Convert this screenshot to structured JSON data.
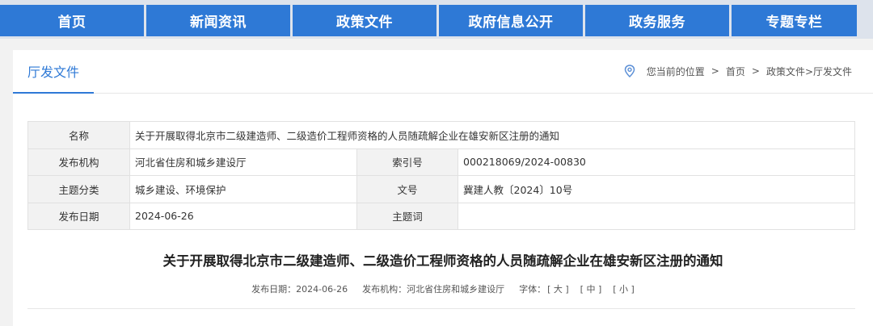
{
  "nav": {
    "items": [
      "首页",
      "新闻资讯",
      "政策文件",
      "政府信息公开",
      "政务服务",
      "专题专栏"
    ]
  },
  "section_title": "厅发文件",
  "breadcrumb": {
    "prefix": "您当前的位置",
    "home": "首页",
    "path": "政策文件>厅发文件"
  },
  "info": {
    "name_key": "名称",
    "name_value": "关于开展取得北京市二级建造师、二级造价工程师资格的人员随疏解企业在雄安新区注册的通知",
    "org_key": "发布机构",
    "org_value": "河北省住房和城乡建设厅",
    "index_key": "索引号",
    "index_value": "000218069/2024-00830",
    "topic_key": "主题分类",
    "topic_value": "城乡建设、环境保护",
    "docno_key": "文号",
    "docno_value": "冀建人教〔2024〕10号",
    "date_key": "发布日期",
    "date_value": "2024-06-26",
    "keywords_key": "主题词",
    "keywords_value": ""
  },
  "document": {
    "title": "关于开展取得北京市二级建造师、二级造价工程师资格的人员随疏解企业在雄安新区注册的通知",
    "meta_date": "发布日期：2024-06-26",
    "meta_org": "发布机构：河北省住房和城乡建设厅",
    "font_label": "字体：",
    "font_large": "[ 大 ]",
    "font_medium": "[ 中 ]",
    "font_small": "[ 小 ]"
  },
  "colors": {
    "accent": "#2e79d6",
    "nav_bg": "#dde3ec"
  }
}
